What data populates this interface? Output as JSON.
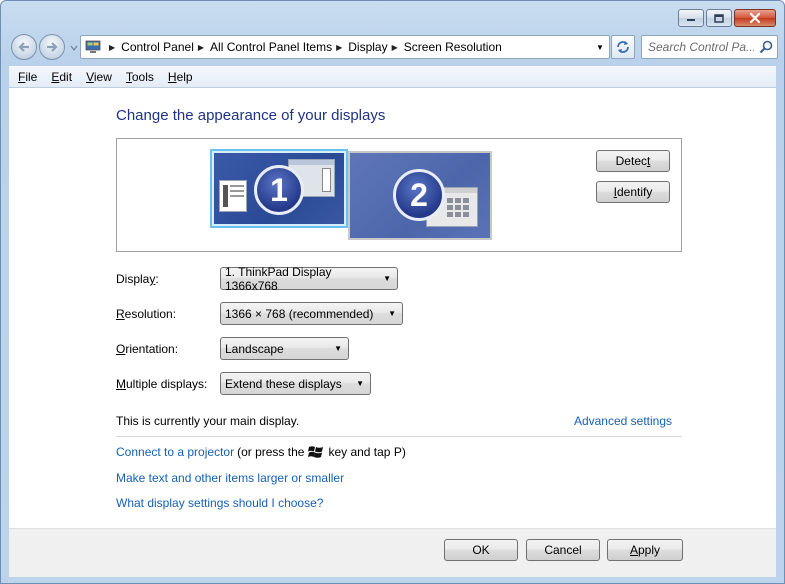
{
  "window": {
    "caption_buttons": [
      "minimize",
      "maximize",
      "close"
    ]
  },
  "nav": {
    "breadcrumbs": [
      "Control Panel",
      "All Control Panel Items",
      "Display",
      "Screen Resolution"
    ],
    "search_placeholder": "Search Control Pa..."
  },
  "menu": {
    "items": [
      {
        "label": "File",
        "accel": "F",
        "rest": "ile"
      },
      {
        "label": "Edit",
        "accel": "E",
        "rest": "dit"
      },
      {
        "label": "View",
        "accel": "V",
        "rest": "iew"
      },
      {
        "label": "Tools",
        "accel": "T",
        "rest": "ools"
      },
      {
        "label": "Help",
        "accel": "H",
        "rest": "elp"
      }
    ]
  },
  "content": {
    "title": "Change the appearance of your displays",
    "monitors": [
      {
        "number": "1",
        "selected": true
      },
      {
        "number": "2",
        "selected": false
      }
    ],
    "detect_button": {
      "accel": "t",
      "pre": "Detec",
      "post": ""
    },
    "identify_button": {
      "accel": "I",
      "pre": "",
      "post": "dentify"
    },
    "fields": {
      "display": {
        "label_pre": "Displa",
        "label_accel": "y",
        "label_post": ":",
        "value": "1. ThinkPad Display 1366x768"
      },
      "resolution": {
        "label_pre": "",
        "label_accel": "R",
        "label_post": "esolution:",
        "value": "1366 × 768 (recommended)"
      },
      "orientation": {
        "label_pre": "",
        "label_accel": "O",
        "label_post": "rientation:",
        "value": "Landscape"
      },
      "multiple": {
        "label_pre": "",
        "label_accel": "M",
        "label_post": "ultiple displays:",
        "value": "Extend these displays"
      }
    },
    "main_display_text": "This is currently your main display.",
    "advanced_link": "Advanced settings",
    "projector": {
      "link": "Connect to a projector",
      "text_before": "(or press the",
      "text_after": "key and tap P)"
    },
    "link_text_larger": "Make text and other items larger or smaller",
    "link_which_settings": "What display settings should I choose?"
  },
  "footer": {
    "ok": "OK",
    "cancel": "Cancel",
    "apply_accel": "A",
    "apply_rest": "pply"
  },
  "colors": {
    "title_blue": "#1e3287",
    "link_blue": "#1660b5",
    "monitor_blue": "#2b4a96",
    "selection_outline": "#6bc0f2"
  }
}
